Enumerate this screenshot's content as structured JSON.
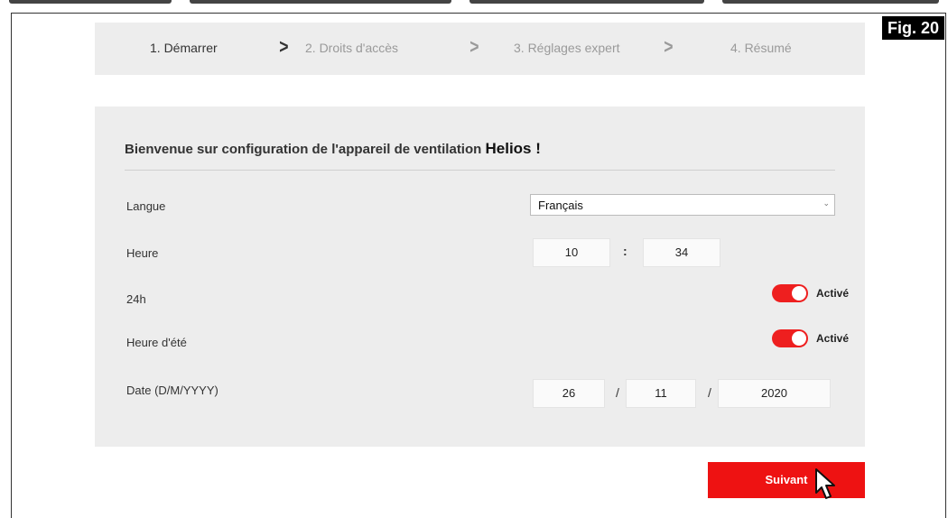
{
  "figure_label": "Fig. 20",
  "wizard": {
    "steps": [
      {
        "label": "1. Démarrer",
        "active": true
      },
      {
        "label": "2. Droits d'accès",
        "active": false
      },
      {
        "label": "3. Réglages expert",
        "active": false
      },
      {
        "label": "4. Résumé",
        "active": false
      }
    ]
  },
  "form": {
    "title_prefix": "Bienvenue sur configuration de l'appareil de ventilation",
    "title_brand": "Helios !",
    "language": {
      "label": "Langue",
      "value": "Français"
    },
    "time": {
      "label": "Heure",
      "hour": "10",
      "minute": "34",
      "separator": ":"
    },
    "format24h": {
      "label": "24h",
      "state": "Activé"
    },
    "dst": {
      "label": "Heure d'été",
      "state": "Activé"
    },
    "date": {
      "label": "Date (D/M/YYYY)",
      "day": "26",
      "month": "11",
      "year": "2020",
      "separator": "/"
    }
  },
  "actions": {
    "next_label": "Suivant"
  },
  "colors": {
    "accent": "#ee1212",
    "panel": "#ededed"
  },
  "icons": [
    "chevron-right-icon",
    "chevron-down-icon",
    "cursor-pointer-icon"
  ]
}
